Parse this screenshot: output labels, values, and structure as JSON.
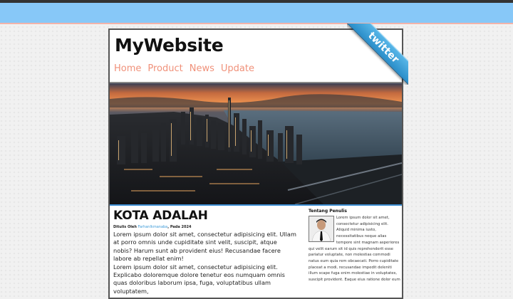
{
  "site": {
    "title": "MyWebsite"
  },
  "nav": {
    "items": [
      "Home",
      "Product",
      "News",
      "Update"
    ]
  },
  "ribbon": {
    "label": "twitter"
  },
  "hero": {
    "alt": "City skyline at sunset"
  },
  "article": {
    "title": "KOTA ADALAH",
    "byline_prefix": "Ditulis Oleh",
    "author_link": "FarhanIkmanaba",
    "byline_suffix": ", Pada 2024",
    "paragraphs": [
      "Lorem ipsum dolor sit amet, consectetur adipisicing elit. Ullam at porro omnis unde cupiditate sint velit, suscipit, atque nobis? Harum sunt ab provident eius! Recusandae facere labore ab repellat enim!",
      "Lorem ipsum dolor sit amet, consectetur adipisicing elit. Explicabo doloremque dolore tenetur eos numquam omnis quas doloribus laborum ipsa, fuga, voluptatibus ullam voluptatem,"
    ]
  },
  "sidebar": {
    "title": "Tentang Penulis",
    "text": "Lorem ipsum dolor sit amet, consectetur adipisicing elit. Aliquid minima iusto, necessitatibus neque alias tempore sint magnam asperiores qui velit earum sit id quis reprehenderit esse pariatur voluptate, non molestias commodi natus eum quia rem obcaecati. Porro cupiditate placeat a modi, recusandae impedit deleniti illum scape fuga enim molestiae in voluptates, suscipit provident. Eaque eius ratione dolor eum"
  },
  "colors": {
    "top_bar": "#87c8f8",
    "nav_link": "#f0917a",
    "link": "#3c9ad8",
    "ribbon": "#3a9dd8"
  }
}
